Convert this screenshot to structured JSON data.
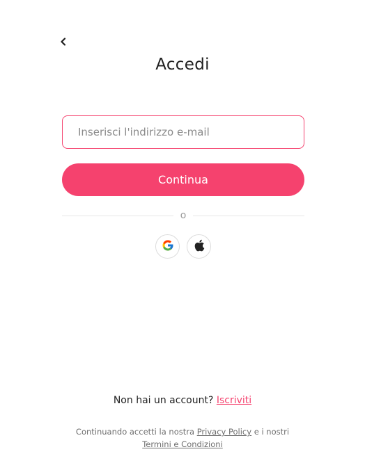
{
  "header": {
    "back_icon": "chevron-left-icon",
    "title": "Accedi"
  },
  "form": {
    "email_placeholder": "Inserisci l'indirizzo e-mail",
    "email_value": "",
    "continue_label": "Continua",
    "divider_text": "o"
  },
  "social": {
    "google_icon": "google-icon",
    "apple_icon": "apple-icon"
  },
  "signup": {
    "prompt": "Non hai un account?",
    "link": "Iscriviti"
  },
  "legal": {
    "prefix": "Continuando accetti la nostra",
    "privacy_link": "Privacy Policy",
    "middle": "e i nostri",
    "terms_link": "Termini e Condizioni"
  },
  "colors": {
    "accent": "#f5426e",
    "text": "#1f1f1f",
    "muted": "#6e6e6e"
  }
}
